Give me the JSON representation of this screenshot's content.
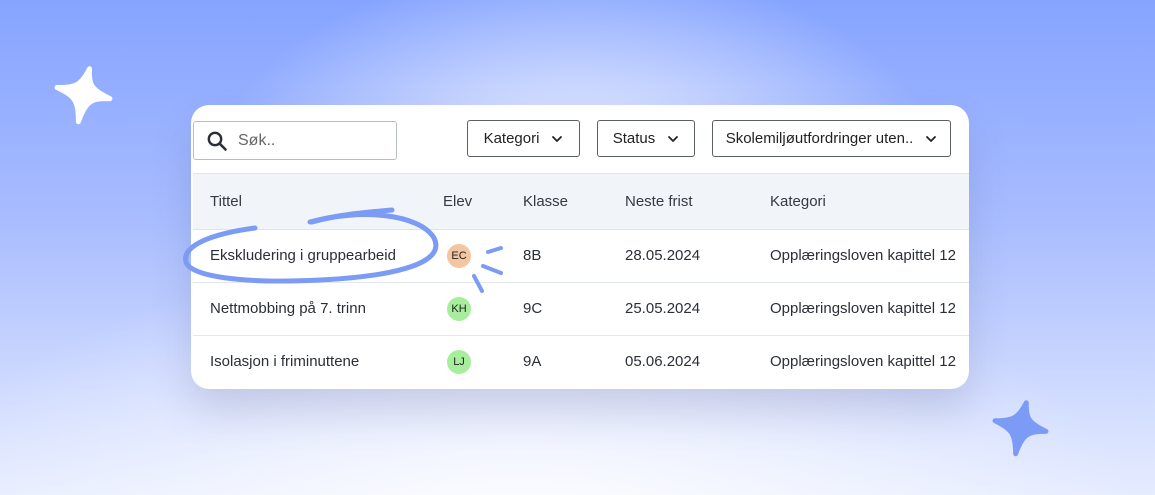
{
  "colors": {
    "accent": "#7c9bf5",
    "avatar_ec": "#f3c5a0",
    "avatar_green": "#a7ee9c",
    "header_bg": "#f1f5fa"
  },
  "search": {
    "placeholder": "Søk..",
    "value": "",
    "icon": "search-icon"
  },
  "filters": {
    "kategori": "Kategori",
    "status": "Status",
    "skolemiljo": "Skolemiljøutfordringer uten.."
  },
  "table": {
    "headers": {
      "title": "Tittel",
      "elev": "Elev",
      "klasse": "Klasse",
      "frist": "Neste frist",
      "kategori": "Kategori"
    },
    "rows": [
      {
        "title": "Ekskludering i gruppearbeid",
        "elev": "EC",
        "klasse": "8B",
        "frist": "28.05.2024",
        "kategori": "Opplæringsloven kapittel 12"
      },
      {
        "title": "Nettmobbing på 7. trinn",
        "elev": "KH",
        "klasse": "9C",
        "frist": "25.05.2024",
        "kategori": "Opplæringsloven kapittel 12"
      },
      {
        "title": "Isolasjon i friminuttene",
        "elev": "LJ",
        "klasse": "9A",
        "frist": "05.06.2024",
        "kategori": "Opplæringsloven kapittel 12"
      }
    ]
  }
}
